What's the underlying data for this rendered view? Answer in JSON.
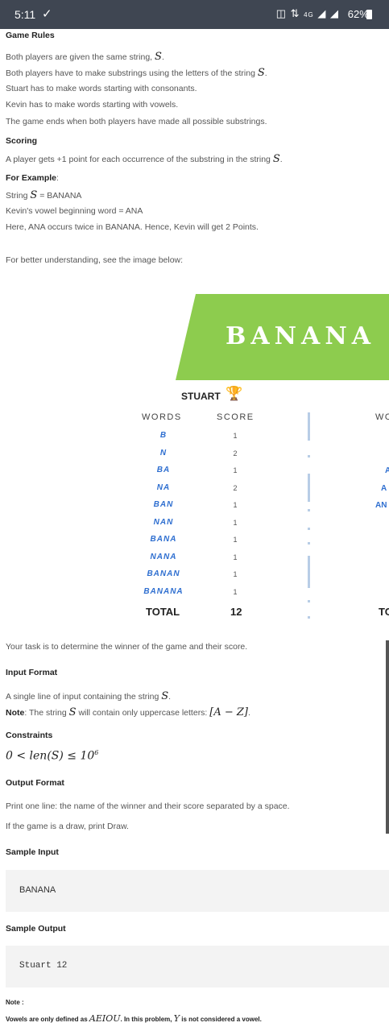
{
  "status_bar": {
    "time": "5:11",
    "signal_text": "4G",
    "battery": "62%"
  },
  "rules": {
    "heading": "Game Rules",
    "line1": "Both players are given the same string,",
    "line2": "Both players have to make substrings using the letters of the string",
    "line3": "Stuart has to make words starting with consonants.",
    "line4": "Kevin has to make words starting with vowels.",
    "line5": "The game ends when both players have made all possible substrings.",
    "var": "S",
    "dot": "."
  },
  "scoring": {
    "heading": "Scoring",
    "line": "A player gets +1 point for each occurrence of the substring in the string",
    "example_label": "For Example",
    "example_colon": ":",
    "string_prefix": "String",
    "string_value": "= BANANA",
    "kevin_line": "Kevin's vowel beginning word = ANA",
    "here_line": "Here, ANA occurs twice in BANANA. Hence, Kevin will get 2 Points.",
    "better_line": "For better understanding, see the image below:"
  },
  "figure": {
    "banner_word": "BANANA",
    "player": "STUART",
    "col_words": "WORDS",
    "col_score": "SCORE",
    "col_words_right": "WO",
    "rows": [
      {
        "word": "B",
        "score": "1"
      },
      {
        "word": "N",
        "score": "2"
      },
      {
        "word": "BA",
        "score": "1"
      },
      {
        "word": "NA",
        "score": "2"
      },
      {
        "word": "BAN",
        "score": "1"
      },
      {
        "word": "NAN",
        "score": "1"
      },
      {
        "word": "BANA",
        "score": "1"
      },
      {
        "word": "NANA",
        "score": "1"
      },
      {
        "word": "BANAN",
        "score": "1"
      },
      {
        "word": "BANANA",
        "score": "1"
      }
    ],
    "right_rows": [
      "A",
      "A",
      "AN"
    ],
    "total_label": "TOTAL",
    "total_value": "12",
    "total_right": "TO"
  },
  "task": {
    "line": "Your task is to determine the winner of the game and their score."
  },
  "input_format": {
    "heading": "Input Format",
    "line": "A single line of input containing the string",
    "note_label": "Note",
    "note_text": ": The string",
    "note_text2": "will contain only uppercase letters:",
    "range": "[A − Z]",
    "dot": "."
  },
  "constraints": {
    "heading": "Constraints",
    "expr": "0 < len(S) ≤ 10"
  },
  "output_format": {
    "heading": "Output Format",
    "line1": "Print one line: the name of the winner and their score separated by a space.",
    "line2": "If the game is a draw, print Draw."
  },
  "sample_input": {
    "heading": "Sample Input",
    "value": "BANANA"
  },
  "sample_output": {
    "heading": "Sample Output",
    "value": "Stuart 12"
  },
  "note": {
    "label": "Note :",
    "text_a": "Vowels are only defined as",
    "vowels": "AEIOU",
    "text_b": ". In this problem,",
    "y": "Y",
    "text_c": "is not considered a vowel."
  }
}
